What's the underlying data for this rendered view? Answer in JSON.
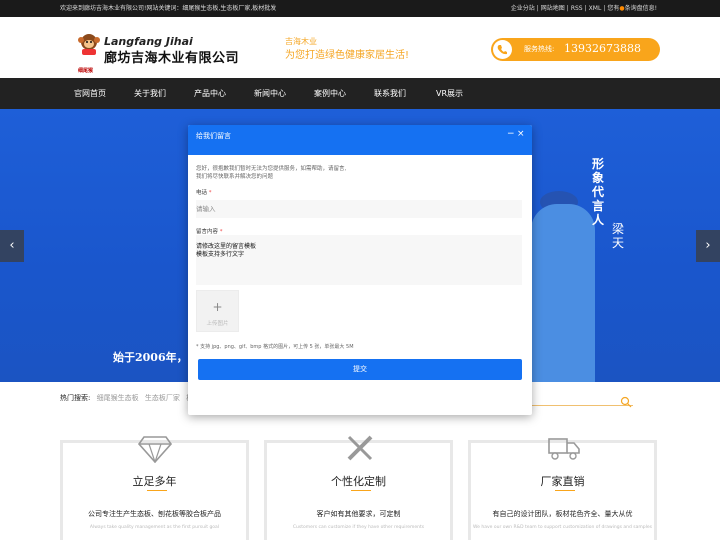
{
  "topbar": {
    "welcome": "欢迎来到廊坊吉海木业有限公司!网站关键词：细尾猴生态板,生态板厂家,板材批发",
    "links": [
      "企业分站",
      "网站地图",
      "RSS",
      "XML"
    ],
    "notice_pre": "您有",
    "notice_post": "条询盘信息!"
  },
  "header": {
    "logo_en": "Langfang Jihai",
    "logo_cn": "廊坊吉海木业有限公司",
    "logo_mark_text": "细尾猴",
    "slogan_1": "吉海木业",
    "slogan_2": "为您打造绿色健康家居生活!",
    "hotline_label": "服务热线:",
    "hotline_number": "13932673888"
  },
  "nav": {
    "items": [
      "官网首页",
      "关于我们",
      "产品中心",
      "新闻中心",
      "案例中心",
      "联系我们",
      "VR展示"
    ]
  },
  "banner": {
    "spokesperson": "形象代言人",
    "signature": "梁天",
    "since_text": "始于2006年，多"
  },
  "hot_search": {
    "label": "热门搜索:",
    "keywords": [
      "细尾猴生态板",
      "生态板厂家",
      "板"
    ]
  },
  "features": [
    {
      "title": "立足多年",
      "desc": "公司专注生产生态板、刨花板等胶合板产品",
      "en": "Always take quality management as the first pursuit goal",
      "icon": "diamond-icon"
    },
    {
      "title": "个性化定制",
      "desc": "客户如有其他要求，可定制",
      "en": "Customers can customize if they have other requirements",
      "icon": "pencil-ruler-icon"
    },
    {
      "title": "厂家直销",
      "desc": "有自己的设计团队，板材花色齐全、量大从优",
      "en": "We have our own R&D team to support customization of drawings and samples",
      "icon": "truck-icon"
    }
  ],
  "modal": {
    "title": "给我们留言",
    "minimize": "−",
    "close": "×",
    "intro_1": "您好，很抱歉我们暂时无法为您提供服务，如需帮助，请留言,",
    "intro_2": "我们将尽快联系并解决您的问题",
    "phone_label": "电话",
    "phone_placeholder": "请输入",
    "message_label": "留言内容",
    "message_line_1": "请修改这里的留言模板",
    "message_line_2": "模板支持多行文字",
    "upload_plus": "+",
    "upload_label": "上传图片",
    "upload_hint": "* 支持 jpg、png、gif、bmp 格式的图片，可上传 5 张，单张最大 5M",
    "submit_label": "提交"
  },
  "colors": {
    "accent_orange": "#f9a51b",
    "modal_blue": "#1571f2",
    "nav_dark": "#222222",
    "banner_blue": "#1e5fd8"
  }
}
